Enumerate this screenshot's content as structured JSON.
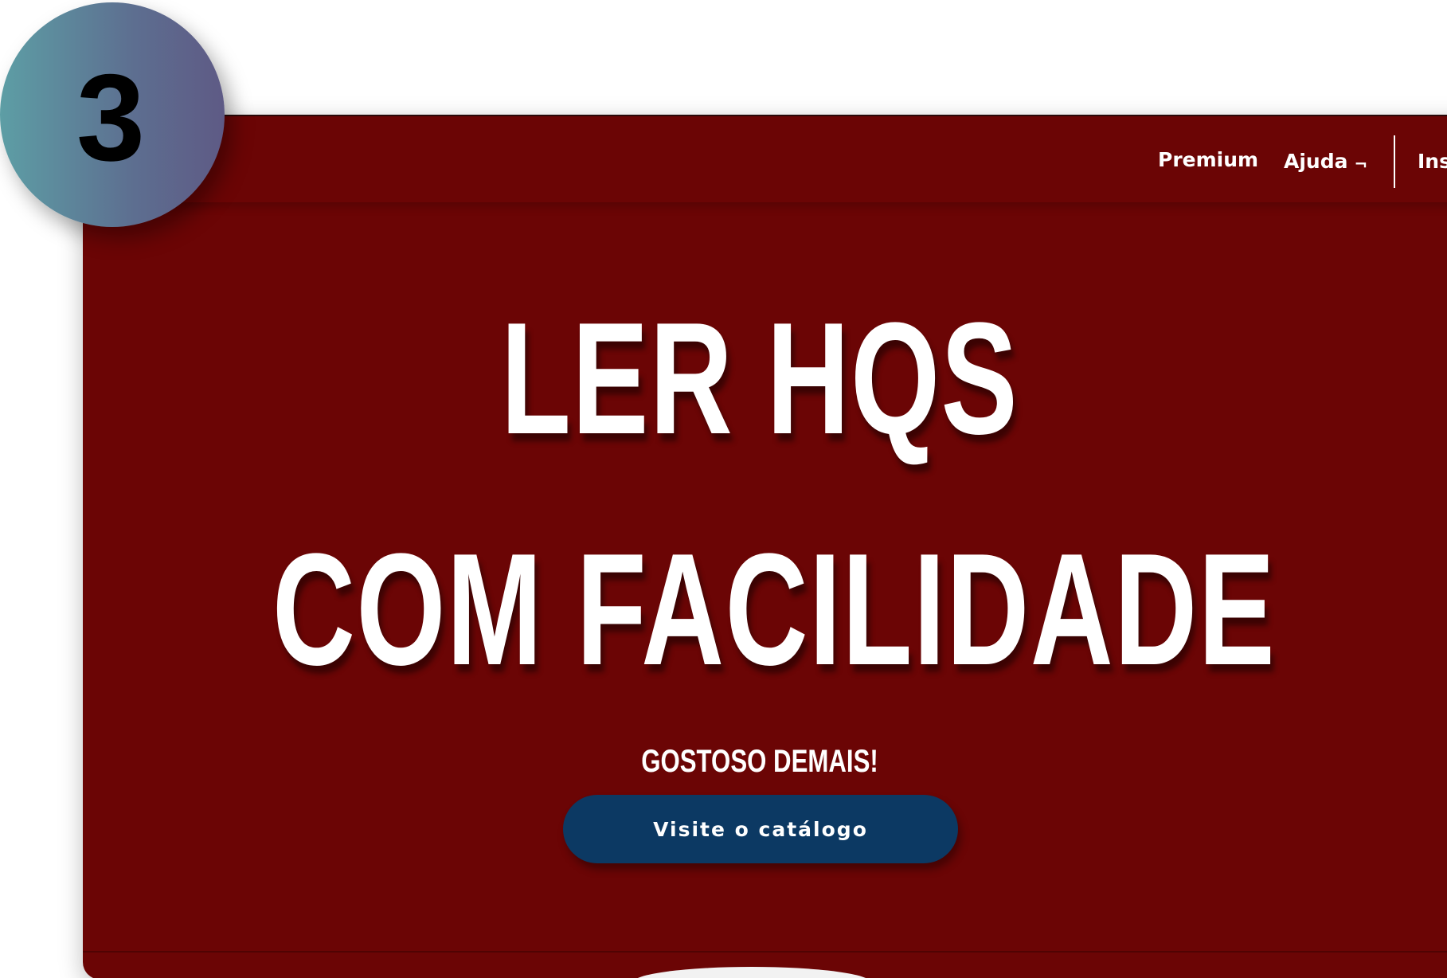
{
  "badge": {
    "step_number": "3"
  },
  "nav": {
    "premium": "Premium",
    "ajuda": "Ajuda",
    "ajuda_chevron": "¬",
    "ins": "Ins"
  },
  "hero": {
    "title_line1": "LER HQS",
    "title_line2": "COM FACILIDADE",
    "subtitle": "GOSTOSO DEMAIS!",
    "cta_label": "Visite o catálogo"
  },
  "colors": {
    "site_background": "#6b0505",
    "cta_background": "#0c3963",
    "text": "#ffffff",
    "badge_gradient_start": "#5d9ea5",
    "badge_gradient_end": "#5e5a85"
  }
}
